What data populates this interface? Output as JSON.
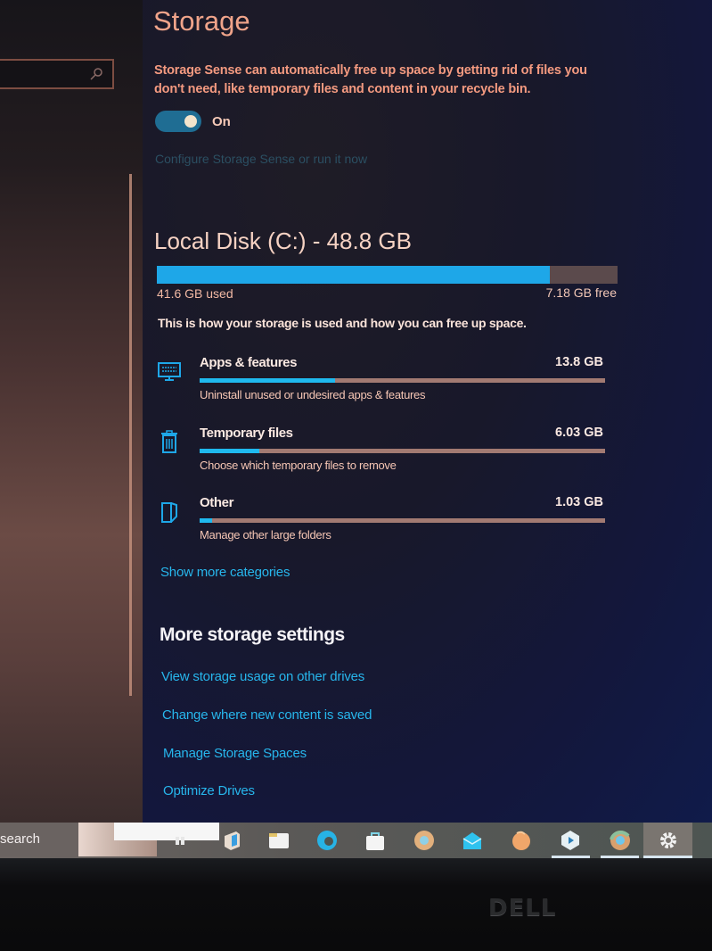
{
  "window": {
    "title": "Storage",
    "left_search": {
      "placeholder": "",
      "icon": "search-icon"
    }
  },
  "storage_sense": {
    "description": "Storage Sense can automatically free up space by getting rid of files you don't need, like temporary files and content in your recycle bin.",
    "toggle_state": "On",
    "toggle_on": true,
    "configure_link": "Configure Storage Sense or run it now"
  },
  "disk": {
    "title": "Local Disk (C:) - 48.8 GB",
    "used_label": "41.6 GB used",
    "free_label": "7.18 GB free",
    "used_fraction": 0.853,
    "note": "This is how your storage is used and how you can free up space."
  },
  "categories": [
    {
      "icon": "monitor-icon",
      "name": "Apps & features",
      "size": "13.8 GB",
      "fraction": 0.335,
      "sub": "Uninstall unused or undesired apps & features"
    },
    {
      "icon": "trash-icon",
      "name": "Temporary files",
      "size": "6.03 GB",
      "fraction": 0.147,
      "sub": "Choose which temporary files to remove"
    },
    {
      "icon": "folder-icon",
      "name": "Other",
      "size": "1.03 GB",
      "fraction": 0.03,
      "sub": "Manage other large folders"
    }
  ],
  "show_more": "Show more categories",
  "more_settings": {
    "title": "More storage settings",
    "links": [
      "View storage usage on other drives",
      "Change where new content is saved",
      "Manage Storage Spaces",
      "Optimize Drives"
    ]
  },
  "taskbar": {
    "search_label": "search",
    "apps": [
      {
        "name": "task-view-icon"
      },
      {
        "name": "office-icon"
      },
      {
        "name": "file-explorer-icon"
      },
      {
        "name": "edge-icon"
      },
      {
        "name": "store-icon"
      },
      {
        "name": "chrome-icon"
      },
      {
        "name": "mail-icon"
      },
      {
        "name": "firefox-icon"
      },
      {
        "name": "media-app-icon",
        "active": true
      },
      {
        "name": "chrome-icon-2",
        "active": true
      },
      {
        "name": "settings-icon",
        "active": true
      }
    ]
  },
  "monitor": {
    "brand": "DELL"
  },
  "colors": {
    "accent": "#1ea7e8",
    "link": "#27b6ec",
    "bar_track": "#5b4a4c"
  }
}
